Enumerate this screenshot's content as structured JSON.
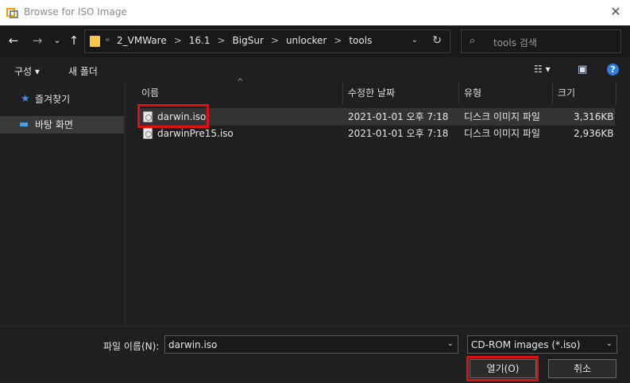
{
  "window": {
    "title": "Browse for ISO Image",
    "close_glyph": "✕"
  },
  "nav": {
    "back_glyph": "←",
    "forward_glyph": "→",
    "recent_glyph": "⌄",
    "up_glyph": "↑",
    "overflow_chevron": "«",
    "breadcrumbs": [
      "2_VMWare",
      "16.1",
      "BigSur",
      "unlocker",
      "tools"
    ],
    "breadcrumb_separator": ">",
    "address_dropdown_glyph": "⌄",
    "refresh_glyph": "↻",
    "search_placeholder": "tools 검색",
    "search_glyph": "⌕"
  },
  "toolbar": {
    "organize_label": "구성 ▾",
    "new_folder_label": "새 폴더",
    "view_glyph": "☷ ▾",
    "pane_glyph": "▣",
    "help_glyph": "?"
  },
  "sidebar": {
    "items": [
      {
        "label": "즐겨찾기",
        "icon": "star-icon",
        "glyph": "★",
        "selected": false
      },
      {
        "label": "바탕 화면",
        "icon": "desktop-icon",
        "glyph": "▬",
        "selected": true
      }
    ]
  },
  "filelist": {
    "columns": [
      "이름",
      "수정한 날짜",
      "유형",
      "크기"
    ],
    "sort_indicator": "^",
    "rows": [
      {
        "name": "darwin.iso",
        "modified": "2021-01-01 오후 7:18",
        "type": "디스크 이미지 파일",
        "size": "3,316KB",
        "selected": true
      },
      {
        "name": "darwinPre15.iso",
        "modified": "2021-01-01 오후 7:18",
        "type": "디스크 이미지 파일",
        "size": "2,936KB",
        "selected": false
      }
    ]
  },
  "bottom": {
    "filename_label": "파일 이름(N):",
    "filename_value": "darwin.iso",
    "filetype_value": "CD-ROM images (*.iso)",
    "dropdown_glyph": "⌄",
    "open_label": "열기(O)",
    "cancel_label": "취소"
  },
  "colors": {
    "background": "#1f1f1f",
    "highlight_annotation": "#e01010",
    "help_blue": "#2f7ee0",
    "folder_yellow": "#f5c74a"
  }
}
